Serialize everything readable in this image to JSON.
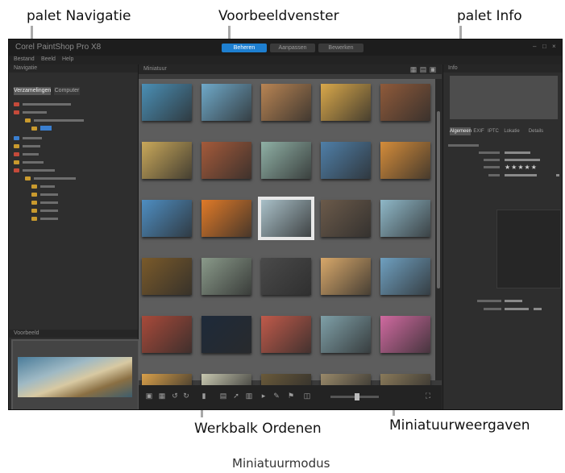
{
  "callouts": {
    "navigator": "palet Navigatie",
    "preview": "Voorbeeldvenster",
    "info": "palet Info",
    "organize_toolbar": "Werkbalk Ordenen",
    "thumbnails": "Miniatuurweergaven"
  },
  "caption": "Miniatuurmodus",
  "app": {
    "title": "Corel PaintShop Pro X8",
    "mode_tabs": [
      "Beheren",
      "Aanpassen",
      "Bewerken"
    ],
    "active_mode": "Beheren",
    "menu": [
      "Bestand",
      "Beeld",
      "Help"
    ],
    "left_panel": {
      "title": "Navigatie",
      "tabs": [
        "Verzamelingen",
        "Computer"
      ],
      "preview_title": "Voorbeeld"
    },
    "center": {
      "title": "Miniatuur",
      "rows": 6,
      "cols": 5
    },
    "right_panel": {
      "title": "Info",
      "tabs": [
        "Algemeen",
        "EXIF",
        "IPTC",
        "Lokatie",
        "Details"
      ],
      "rating": "★★★★★"
    }
  },
  "thumb_colors": [
    [
      "#4a8fb5",
      "#6fa9c9",
      "#b88453",
      "#d9a84a",
      "#8f5a3a"
    ],
    [
      "#c9a85a",
      "#a45a3a",
      "#8fb0a5",
      "#4f7fa8",
      "#d48c3a"
    ],
    [
      "#4e8ec2",
      "#e07a28",
      "#a9c0c8",
      "#6b5a4a",
      "#8fb8c8"
    ],
    [
      "#7a5a2a",
      "#8a9a8a",
      "#4a4a4a",
      "#d8a86a",
      "#6fa0c0"
    ],
    [
      "#a84a3a",
      "#1e2a3a",
      "#c05a4a",
      "#7fa0a8",
      "#d06aa0"
    ],
    [
      "#d9a04a",
      "#c8c8b0",
      "#6a5a3a",
      "#9a8a6a",
      "#8a7a5a"
    ]
  ]
}
